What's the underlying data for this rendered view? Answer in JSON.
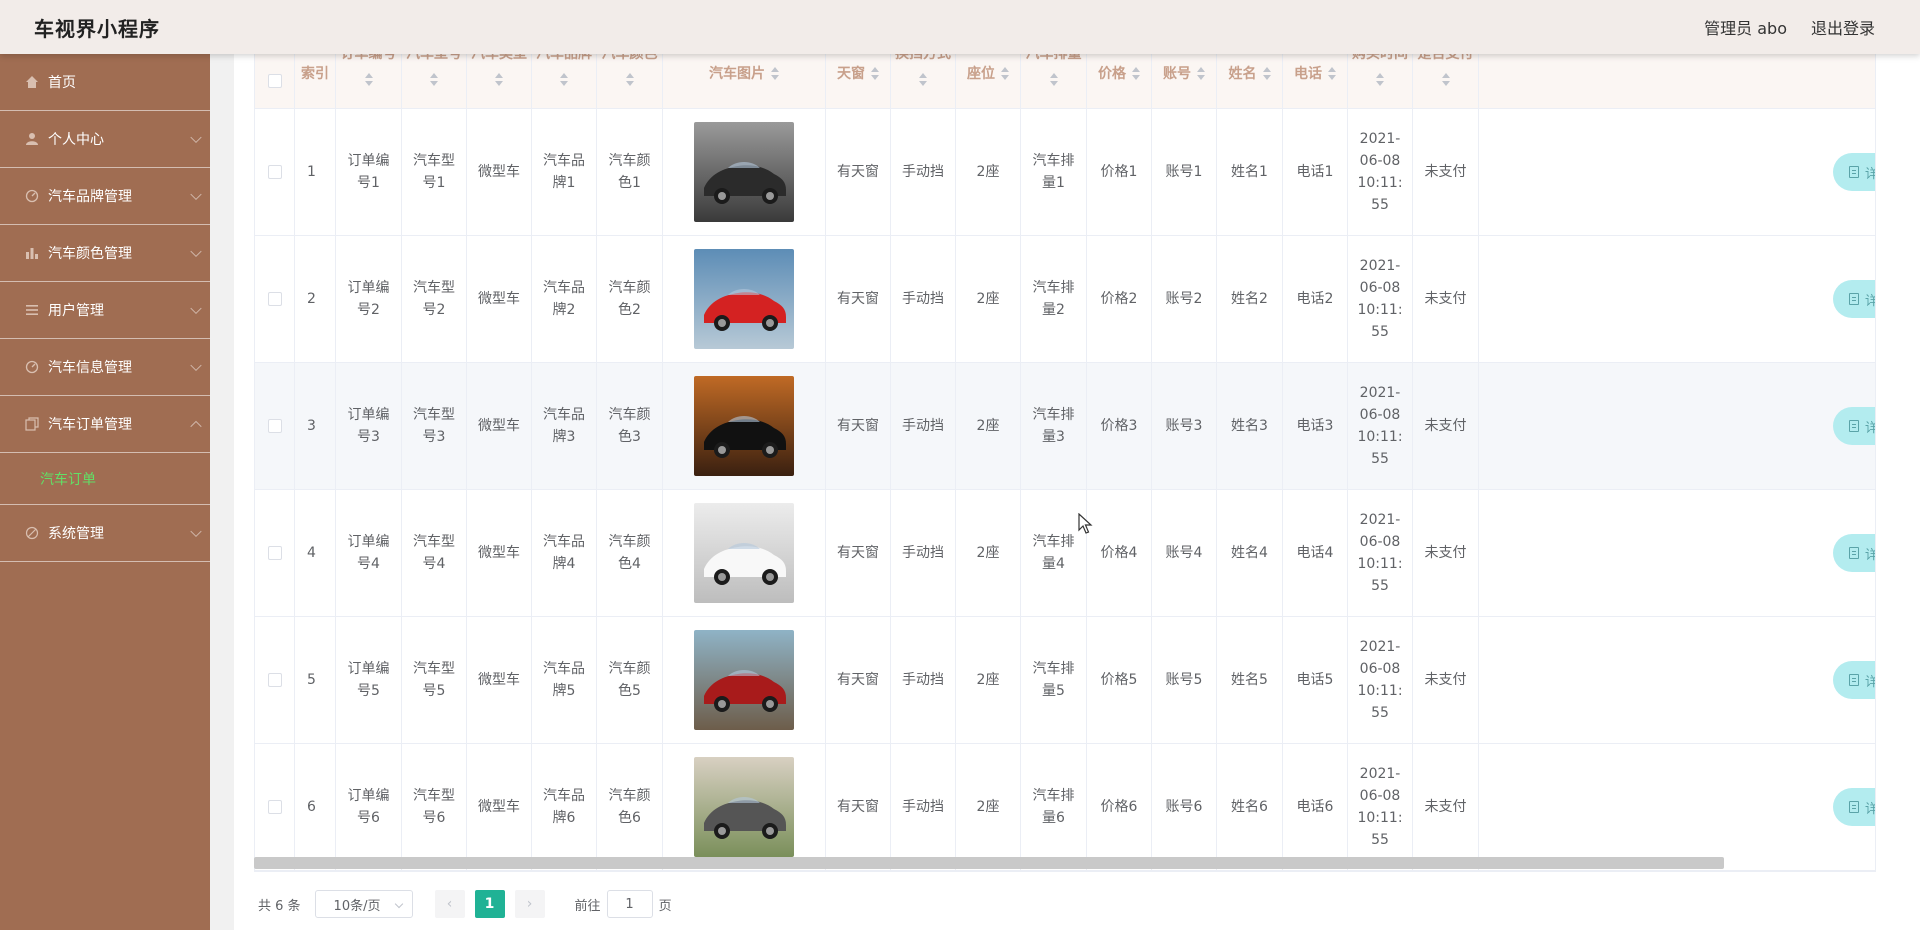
{
  "header": {
    "app_title": "车视界小程序",
    "user_label": "管理员 abo",
    "logout_label": "退出登录"
  },
  "sidebar": {
    "items": [
      {
        "label": "首页",
        "icon": "home-icon"
      },
      {
        "label": "个人中心",
        "icon": "user-icon"
      },
      {
        "label": "汽车品牌管理",
        "icon": "dashboard-icon"
      },
      {
        "label": "汽车颜色管理",
        "icon": "bar-chart-icon"
      },
      {
        "label": "用户管理",
        "icon": "list-icon"
      },
      {
        "label": "汽车信息管理",
        "icon": "dashboard-icon"
      },
      {
        "label": "汽车订单管理",
        "icon": "copy-icon"
      },
      {
        "label": "系统管理",
        "icon": "pen-icon"
      }
    ],
    "active_submenu": "汽车订单"
  },
  "table": {
    "columns": [
      {
        "label": "",
        "type": "checkbox"
      },
      {
        "label": "索引"
      },
      {
        "label": "订单编号",
        "sortable": true
      },
      {
        "label": "汽车型号",
        "sortable": true
      },
      {
        "label": "汽车类型",
        "sortable": true
      },
      {
        "label": "汽车品牌",
        "sortable": true
      },
      {
        "label": "汽车颜色",
        "sortable": true
      },
      {
        "label": "汽车图片",
        "sortable": true
      },
      {
        "label": "天窗",
        "sortable": true
      },
      {
        "label": "换挡方式",
        "sortable": true
      },
      {
        "label": "座位",
        "sortable": true
      },
      {
        "label": "汽车排量",
        "sortable": true
      },
      {
        "label": "价格",
        "sortable": true
      },
      {
        "label": "账号",
        "sortable": true
      },
      {
        "label": "姓名",
        "sortable": true
      },
      {
        "label": "电话",
        "sortable": true
      },
      {
        "label": "购买时间",
        "sortable": true
      },
      {
        "label": "是否支付",
        "sortable": true
      }
    ],
    "rows": [
      {
        "index": "1",
        "order_no": "订单编号1",
        "model": "汽车型号1",
        "type": "微型车",
        "brand": "汽车品牌1",
        "color": "汽车颜色1",
        "image": "dark-sports-car",
        "sunroof": "有天窗",
        "gear": "手动挡",
        "seats": "2座",
        "displacement": "汽车排量1",
        "price": "价格1",
        "account": "账号1",
        "name": "姓名1",
        "phone": "电话1",
        "time": "2021-06-08 10:11:55",
        "paid": "未支付",
        "action": "详情"
      },
      {
        "index": "2",
        "order_no": "订单编号2",
        "model": "汽车型号2",
        "type": "微型车",
        "brand": "汽车品牌2",
        "color": "汽车颜色2",
        "image": "red-convertible",
        "sunroof": "有天窗",
        "gear": "手动挡",
        "seats": "2座",
        "displacement": "汽车排量2",
        "price": "价格2",
        "account": "账号2",
        "name": "姓名2",
        "phone": "电话2",
        "time": "2021-06-08 10:11:55",
        "paid": "未支付",
        "action": "详情"
      },
      {
        "index": "3",
        "order_no": "订单编号3",
        "model": "汽车型号3",
        "type": "微型车",
        "brand": "汽车品牌3",
        "color": "汽车颜色3",
        "image": "black-car-sunset",
        "sunroof": "有天窗",
        "gear": "手动挡",
        "seats": "2座",
        "displacement": "汽车排量3",
        "price": "价格3",
        "account": "账号3",
        "name": "姓名3",
        "phone": "电话3",
        "time": "2021-06-08 10:11:55",
        "paid": "未支付",
        "action": "详情"
      },
      {
        "index": "4",
        "order_no": "订单编号4",
        "model": "汽车型号4",
        "type": "微型车",
        "brand": "汽车品牌4",
        "color": "汽车颜色4",
        "image": "white-concept-car",
        "sunroof": "有天窗",
        "gear": "手动挡",
        "seats": "2座",
        "displacement": "汽车排量4",
        "price": "价格4",
        "account": "账号4",
        "name": "姓名4",
        "phone": "电话4",
        "time": "2021-06-08 10:11:55",
        "paid": "未支付",
        "action": "详情"
      },
      {
        "index": "5",
        "order_no": "订单编号5",
        "model": "汽车型号5",
        "type": "微型车",
        "brand": "汽车品牌5",
        "color": "汽车颜色5",
        "image": "red-suv",
        "sunroof": "有天窗",
        "gear": "手动挡",
        "seats": "2座",
        "displacement": "汽车排量5",
        "price": "价格5",
        "account": "账号5",
        "name": "姓名5",
        "phone": "电话5",
        "time": "2021-06-08 10:11:55",
        "paid": "未支付",
        "action": "详情"
      },
      {
        "index": "6",
        "order_no": "订单编号6",
        "model": "汽车型号6",
        "type": "微型车",
        "brand": "汽车品牌6",
        "color": "汽车颜色6",
        "image": "grey-muscle-car",
        "sunroof": "有天窗",
        "gear": "手动挡",
        "seats": "2座",
        "displacement": "汽车排量6",
        "price": "价格6",
        "account": "账号6",
        "name": "姓名6",
        "phone": "电话6",
        "time": "2021-06-08 10:11:55",
        "paid": "未支付",
        "action": "详情"
      }
    ]
  },
  "pagination": {
    "total_label": "共 6 条",
    "page_size": "10条/页",
    "current_page": "1",
    "goto_prefix": "前往",
    "goto_value": "1",
    "goto_suffix": "页",
    "prev_icon": "chevron-left-icon",
    "next_icon": "chevron-right-icon"
  },
  "colors": {
    "sidebar_bg": "#a06d52",
    "header_bg": "#f2ece9",
    "accent_green": "#20b295",
    "active_submenu": "#62e066",
    "detail_button": "#b3ecef"
  }
}
